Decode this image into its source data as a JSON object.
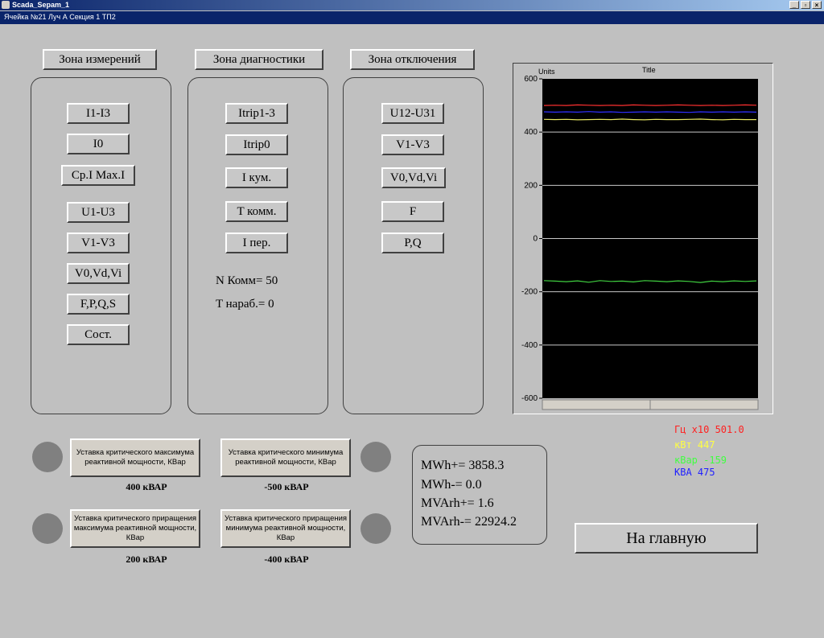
{
  "window": {
    "title": "Scada_Sepam_1",
    "subtitle": "Ячейка №21 Луч А Секция 1 ТП2",
    "min": "_",
    "max": "▫",
    "close": "×"
  },
  "zones": {
    "measure": {
      "title": "Зона измерений",
      "buttons": [
        "I1-I3",
        "I0",
        "Ср.I Max.I",
        "U1-U3",
        "V1-V3",
        "V0,Vd,Vi",
        "F,P,Q,S",
        "Сост."
      ]
    },
    "diag": {
      "title": "Зона диагностики",
      "buttons": [
        "Itrip1-3",
        "Itrip0",
        "I кум.",
        "T комм.",
        "I пер."
      ],
      "n_komm": "N Комм= 50",
      "t_narab": "T нараб.= 0"
    },
    "trip": {
      "title": "Зона отключения",
      "buttons": [
        "U12-U31",
        "V1-V3",
        "V0,Vd,Vi",
        "F",
        "P,Q"
      ]
    }
  },
  "setpoints": [
    {
      "label": "Уставка критического максимума реактивной мощности, КВар",
      "value": "400 кВАР"
    },
    {
      "label": "Уставка критического минимума реактивной мощности, КВар",
      "value": "-500 кВАР"
    },
    {
      "label": "Уставка критического приращения максимума реактивной мощности, КВар",
      "value": "200 кВАР"
    },
    {
      "label": "Уставка критического приращения минимума реактивной мощности, КВар",
      "value": "-400 кВАР"
    }
  ],
  "energy": {
    "mwh_plus": "MWh+= 3858.3",
    "mwh_minus": "MWh-= 0.0",
    "mvarh_plus": "MVArh+= 1.6",
    "mvarh_minus": "MVArh-= 22924.2"
  },
  "home_button": "На главную",
  "legend": [
    {
      "text": "Гц x10 501.0",
      "color": "#ff2020"
    },
    {
      "text": "кВт 447",
      "color": "#ffff40"
    },
    {
      "text": "кВар -159",
      "color": "#40ff40"
    },
    {
      "text": "КВА 475",
      "color": "#2020ff"
    }
  ],
  "chart_data": {
    "type": "line",
    "title": "Title",
    "ylabel": "Units",
    "ylim": [
      -600,
      600
    ],
    "y_ticks": [
      "600",
      "400",
      "200",
      "0",
      "-200",
      "-400",
      "-600"
    ],
    "grid": true,
    "series": [
      {
        "name": "Гц x10",
        "color": "#ff3030",
        "values": [
          500,
          501,
          500,
          502,
          501,
          500,
          501,
          500,
          502,
          501,
          500,
          501,
          502,
          501,
          500,
          501,
          500,
          501,
          502,
          501
        ]
      },
      {
        "name": "КВА",
        "color": "#3030ff",
        "values": [
          476,
          475,
          476,
          475,
          477,
          475,
          476,
          474,
          475,
          476,
          475,
          476,
          475,
          474,
          476,
          475,
          476,
          475,
          476,
          475
        ]
      },
      {
        "name": "кВт",
        "color": "#e8e860",
        "values": [
          448,
          447,
          448,
          446,
          447,
          448,
          447,
          449,
          447,
          446,
          448,
          447,
          447,
          448,
          449,
          447,
          446,
          448,
          447,
          447
        ]
      },
      {
        "name": "кВар",
        "color": "#40d040",
        "values": [
          -158,
          -160,
          -162,
          -159,
          -164,
          -158,
          -161,
          -160,
          -163,
          -158,
          -160,
          -162,
          -159,
          -161,
          -165,
          -160,
          -162,
          -159,
          -161,
          -159
        ]
      }
    ]
  }
}
